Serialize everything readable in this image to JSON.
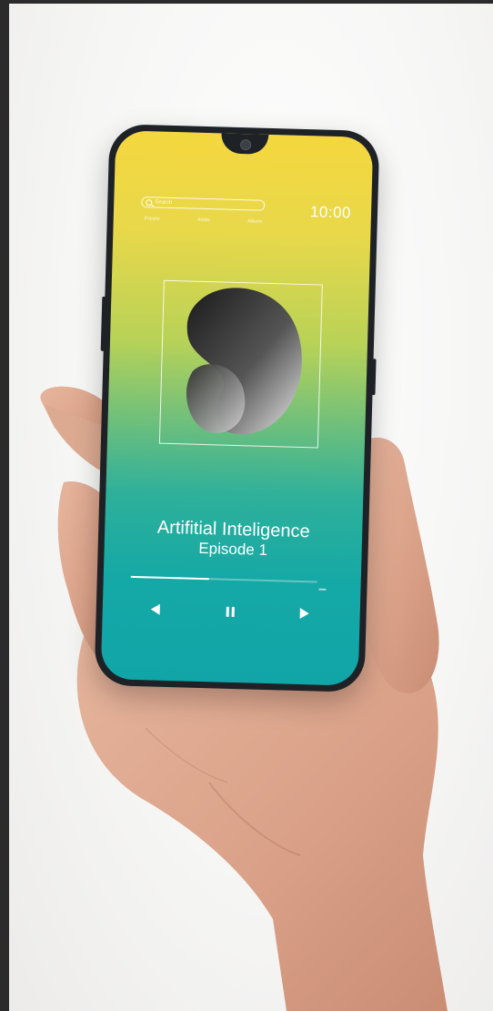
{
  "search": {
    "placeholder": "Search"
  },
  "status": {
    "time": "10:00"
  },
  "nav": {
    "items": [
      "Popular",
      "Artists",
      "Albums"
    ]
  },
  "track": {
    "title": "Artifitial Inteligence",
    "subtitle": "Episode 1",
    "progress": 0.42
  },
  "colors": {
    "gradient_top": "#f4d73e",
    "gradient_bottom": "#12a5a8",
    "frame": "#1e2226"
  },
  "icons": {
    "previous": "previous-icon",
    "pause": "pause-icon",
    "next": "next-icon"
  }
}
